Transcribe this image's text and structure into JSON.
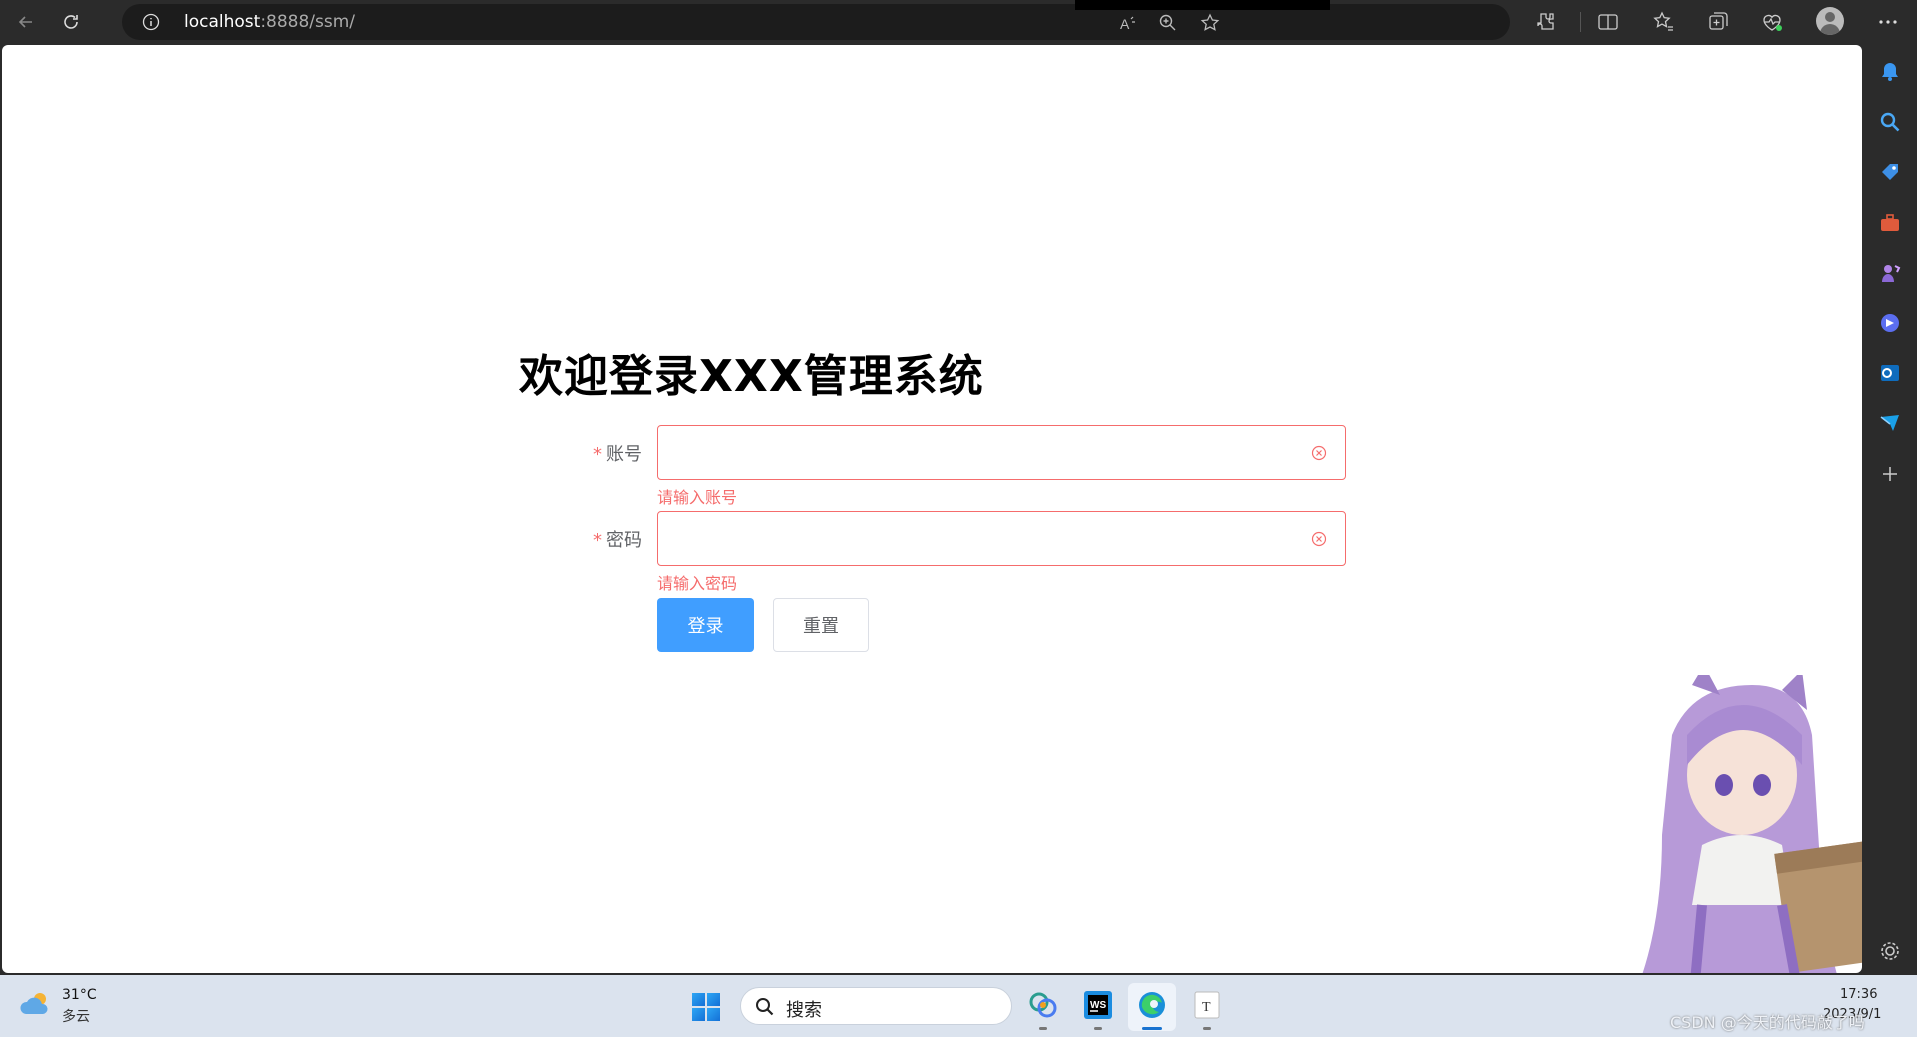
{
  "browser": {
    "url_host": "localhost",
    "url_path": ":8888/ssm/"
  },
  "page": {
    "title": "欢迎登录XXX管理系统",
    "form": {
      "required_mark": "*",
      "account_label": "账号",
      "account_value": "",
      "account_error": "请输入账号",
      "password_label": "密码",
      "password_value": "",
      "password_error": "请输入密码",
      "login_button": "登录",
      "reset_button": "重置"
    }
  },
  "colors": {
    "primary": "#409eff",
    "error": "#f56c6c",
    "text": "#606266"
  },
  "taskbar": {
    "temperature": "31°C",
    "weather": "多云",
    "search_placeholder": "搜索",
    "time": "17:36",
    "date": "2023/9/1",
    "watermark": "CSDN @今天的代码敲了吗"
  }
}
